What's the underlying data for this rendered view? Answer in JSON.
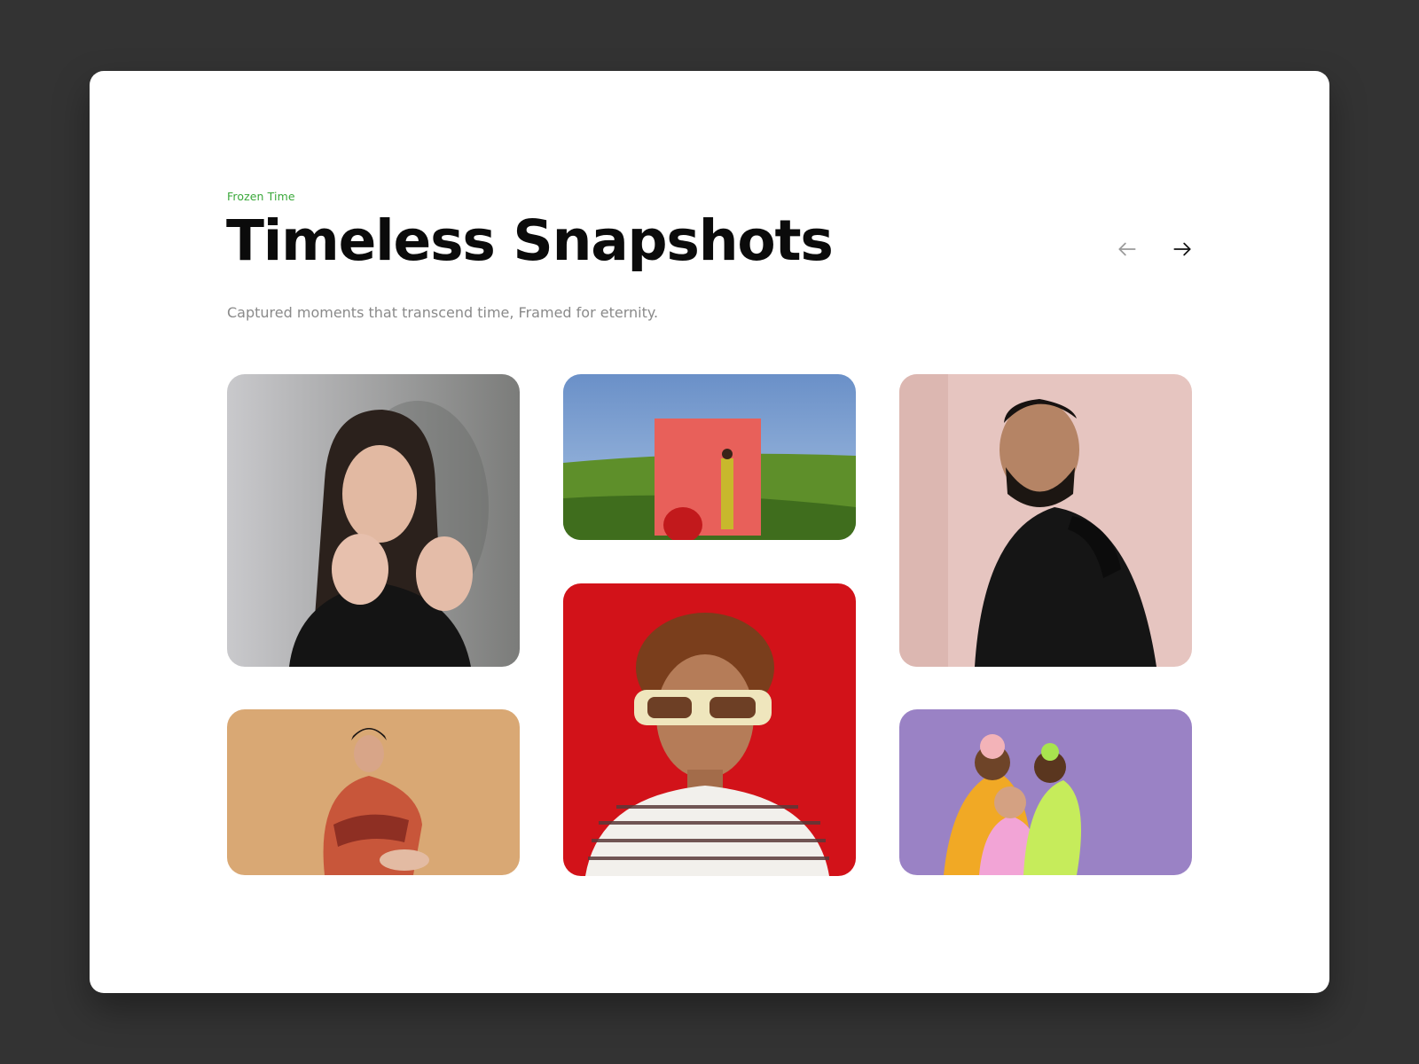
{
  "header": {
    "eyebrow": "Frozen Time",
    "title": "Timeless Snapshots",
    "subtitle": "Captured moments that transcend time, Framed for eternity."
  },
  "navigation": {
    "prev_icon": "arrow-left-icon",
    "next_icon": "arrow-right-icon"
  },
  "colors": {
    "accent": "#3aa83a",
    "page_background": "#333333",
    "card_background": "#ffffff"
  }
}
